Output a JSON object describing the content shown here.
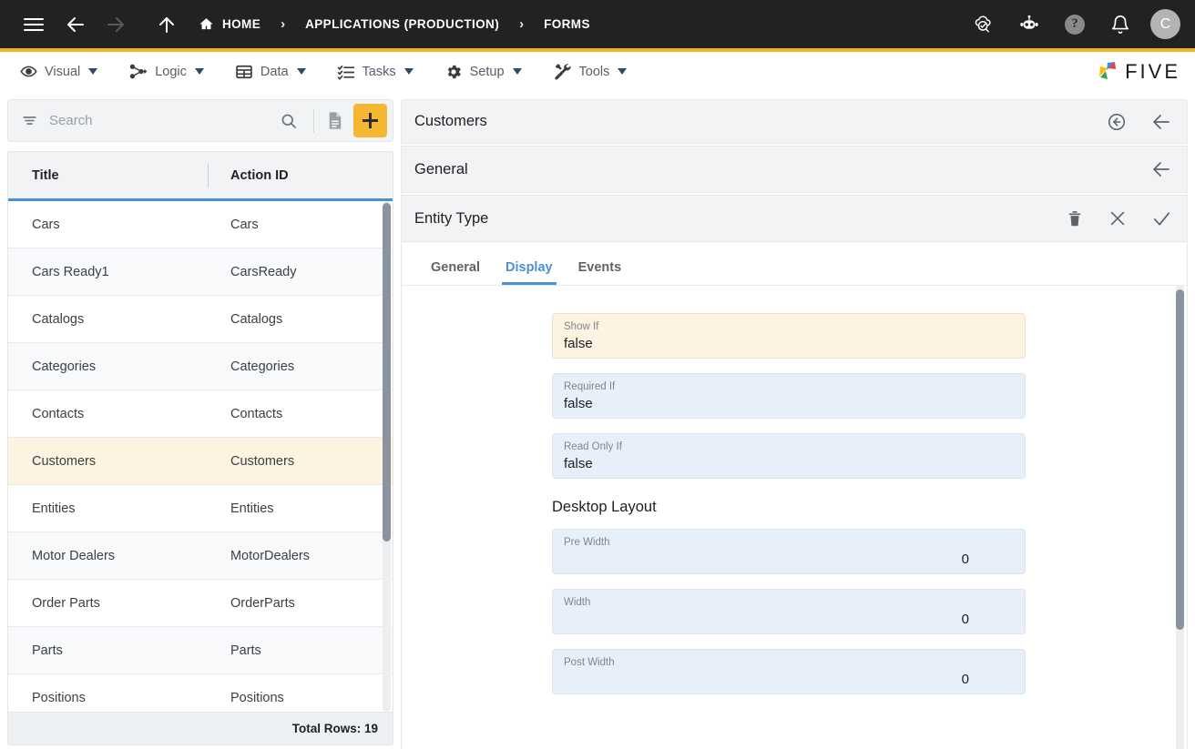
{
  "topbar": {
    "menu_icon": "hamburger-icon",
    "back_icon": "arrow-left-icon",
    "forward_icon": "arrow-right-icon",
    "up_icon": "arrow-up-icon",
    "breadcrumb": [
      {
        "label": "HOME",
        "icon": "home-icon"
      },
      {
        "label": "APPLICATIONS (PRODUCTION)",
        "icon": ""
      },
      {
        "label": "FORMS",
        "icon": ""
      }
    ],
    "separator": "›",
    "actions": [
      {
        "name": "cloud-check-icon",
        "label": ""
      },
      {
        "name": "robot-icon",
        "label": ""
      },
      {
        "name": "help-icon",
        "label": "?"
      },
      {
        "name": "bell-icon",
        "label": ""
      }
    ],
    "avatar_initial": "C",
    "accent_color": "#f5b222"
  },
  "menubar": {
    "items": [
      {
        "label": "Visual",
        "icon": "eye-icon"
      },
      {
        "label": "Logic",
        "icon": "nodes-icon"
      },
      {
        "label": "Data",
        "icon": "table-grid-icon"
      },
      {
        "label": "Tasks",
        "icon": "checklist-icon"
      },
      {
        "label": "Setup",
        "icon": "gear-icon"
      },
      {
        "label": "Tools",
        "icon": "tools-icon"
      }
    ],
    "brand": "FIVE"
  },
  "sidebar": {
    "search": {
      "placeholder": "Search",
      "value": ""
    },
    "filter_icon": "filter-icon",
    "search_icon": "search-icon",
    "document_icon": "document-icon",
    "add_label": "+",
    "columns": [
      "Title",
      "Action ID"
    ],
    "rows": [
      {
        "title": "Cars",
        "action_id": "Cars"
      },
      {
        "title": "Cars Ready1",
        "action_id": "CarsReady"
      },
      {
        "title": "Catalogs",
        "action_id": "Catalogs"
      },
      {
        "title": "Categories",
        "action_id": "Categories"
      },
      {
        "title": "Contacts",
        "action_id": "Contacts"
      },
      {
        "title": "Customers",
        "action_id": "Customers"
      },
      {
        "title": "Entities",
        "action_id": "Entities"
      },
      {
        "title": "Motor Dealers",
        "action_id": "MotorDealers"
      },
      {
        "title": "Order Parts",
        "action_id": "OrderParts"
      },
      {
        "title": "Parts",
        "action_id": "Parts"
      },
      {
        "title": "Positions",
        "action_id": "Positions"
      }
    ],
    "selected_index": 5,
    "footer": "Total Rows: 19"
  },
  "detail": {
    "panels": [
      {
        "title": "Customers",
        "icons": [
          "circle-back-icon",
          "arrow-left-icon"
        ]
      },
      {
        "title": "General",
        "icons": [
          "arrow-left-icon"
        ]
      },
      {
        "title": "Entity Type",
        "icons": [
          "trash-icon",
          "close-icon",
          "check-icon"
        ]
      }
    ],
    "tabs": [
      {
        "label": "General",
        "active": false
      },
      {
        "label": "Display",
        "active": true
      },
      {
        "label": "Events",
        "active": false
      }
    ],
    "fields": [
      {
        "label": "Show If",
        "value": "false",
        "focused": true,
        "align": "left"
      },
      {
        "label": "Required If",
        "value": "false",
        "focused": false,
        "align": "left"
      },
      {
        "label": "Read Only If",
        "value": "false",
        "focused": false,
        "align": "left"
      }
    ],
    "section_title": "Desktop Layout",
    "layout_fields": [
      {
        "label": "Pre Width",
        "value": "0",
        "focused": false,
        "align": "right"
      },
      {
        "label": "Width",
        "value": "0",
        "focused": false,
        "align": "right"
      },
      {
        "label": "Post Width",
        "value": "0",
        "focused": false,
        "align": "right"
      }
    ]
  }
}
